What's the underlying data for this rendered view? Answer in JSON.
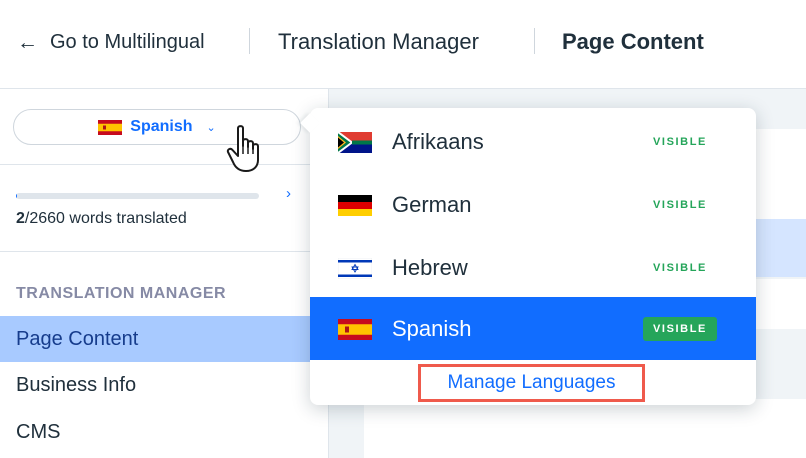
{
  "header": {
    "back_label": "Go to Multilingual",
    "crumb_1": "Translation Manager",
    "crumb_2": "Page Content"
  },
  "sidebar": {
    "language_selector": {
      "flag": "spain-flag-icon",
      "label": "Spanish"
    },
    "progress": {
      "translated": "2",
      "total_text": "/2660 words translated",
      "fraction": 0.00075
    },
    "section_title": "TRANSLATION MANAGER",
    "items": [
      {
        "label": "Page Content",
        "active": true
      },
      {
        "label": "Business Info",
        "active": false
      },
      {
        "label": "CMS",
        "active": false
      }
    ]
  },
  "dropdown": {
    "options": [
      {
        "label": "Afrikaans",
        "flag": "south-africa-flag-icon",
        "status": "VISIBLE",
        "selected": false
      },
      {
        "label": "German",
        "flag": "germany-flag-icon",
        "status": "VISIBLE",
        "selected": false
      },
      {
        "label": "Hebrew",
        "flag": "israel-flag-icon",
        "status": "VISIBLE",
        "selected": false
      },
      {
        "label": "Spanish",
        "flag": "spain-flag-icon",
        "status": "VISIBLE",
        "selected": true
      }
    ],
    "manage_label": "Manage Languages"
  },
  "colors": {
    "accent": "#116dff",
    "visible_green": "#25a55a",
    "highlight_border": "#ef5a4c",
    "active_nav": "#a8caff"
  }
}
